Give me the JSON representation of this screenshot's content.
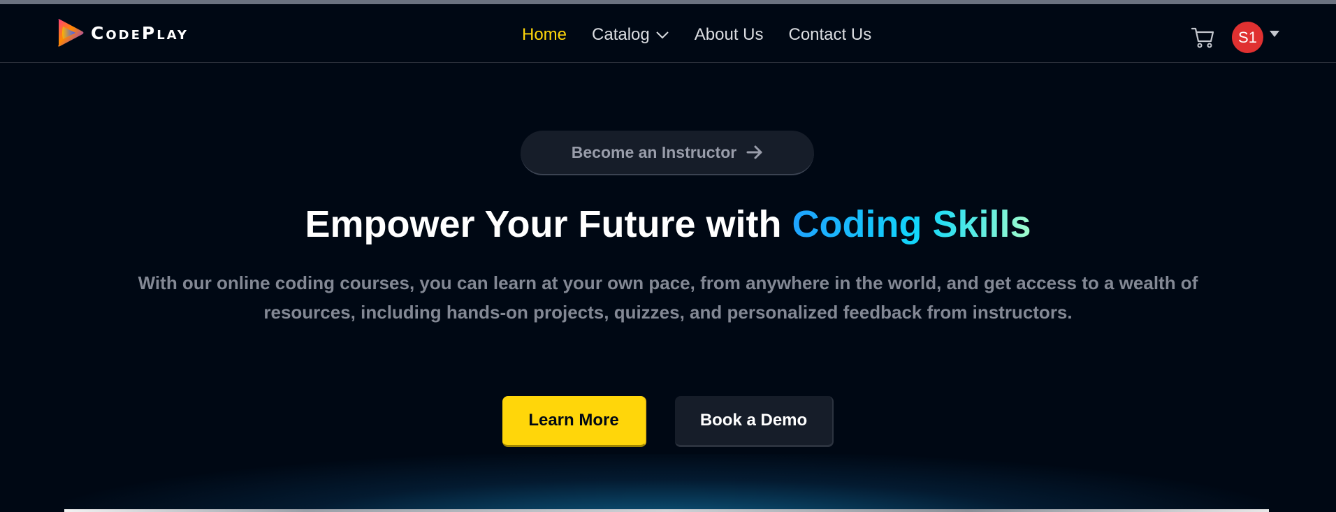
{
  "brand": {
    "name": "CodePlay",
    "logo_icon": "play-logo-icon"
  },
  "nav": {
    "items": [
      {
        "label": "Home",
        "active": true
      },
      {
        "label": "Catalog",
        "has_dropdown": true
      },
      {
        "label": "About Us"
      },
      {
        "label": "Contact Us"
      }
    ]
  },
  "user": {
    "cart_icon": "cart-icon",
    "avatar_initials": "S1",
    "avatar_color": "#e03131"
  },
  "hero": {
    "instructor_cta": "Become an Instructor",
    "headline_prefix": "Empower Your Future with ",
    "headline_highlight": "Coding Skills",
    "subtext": "With our online coding courses, you can learn at your own pace, from anywhere in the world, and get access to a wealth of resources, including hands-on projects, quizzes, and personalized feedback from instructors.",
    "primary_button": "Learn More",
    "secondary_button": "Book a Demo"
  },
  "colors": {
    "background": "#000814",
    "accent_yellow": "#ffd60a",
    "muted_text": "#838894",
    "gradient_start": "#1fa2ff",
    "gradient_end": "#a6ffcb"
  }
}
